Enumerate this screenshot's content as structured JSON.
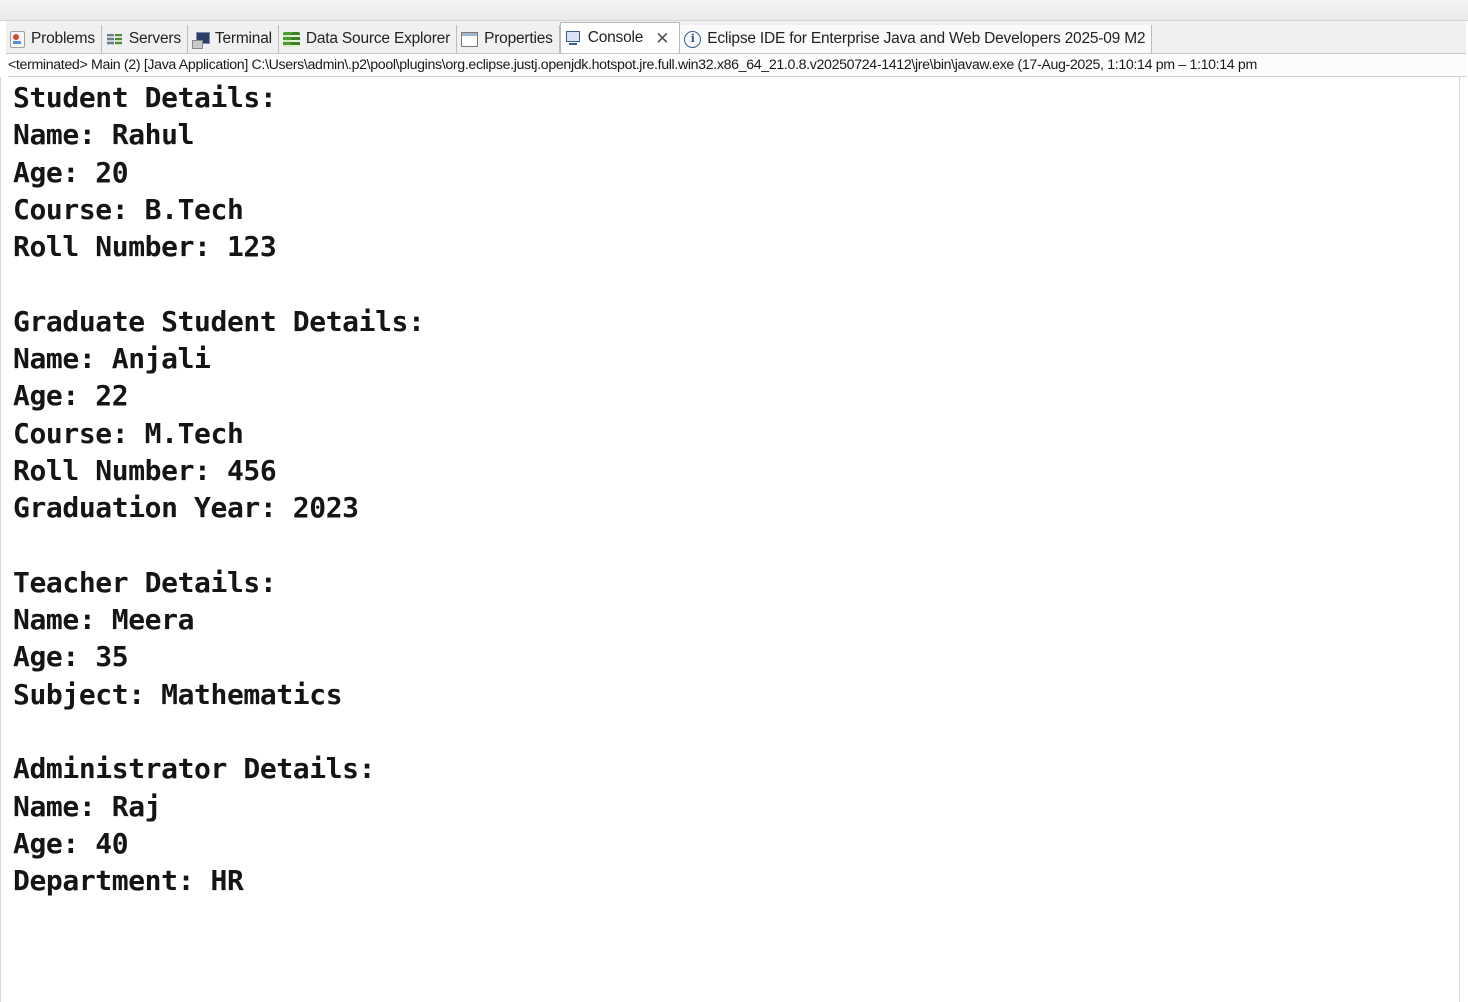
{
  "tabs": [
    {
      "label": "Problems",
      "icon": "problems-icon"
    },
    {
      "label": "Servers",
      "icon": "servers-icon"
    },
    {
      "label": "Terminal",
      "icon": "terminal-icon"
    },
    {
      "label": "Data Source Explorer",
      "icon": "data-source-explorer-icon"
    },
    {
      "label": "Properties",
      "icon": "properties-icon"
    },
    {
      "label": "Console",
      "icon": "console-icon",
      "active": true
    },
    {
      "label": "Eclipse IDE for Enterprise Java and Web Developers 2025-09 M2",
      "icon": "info-icon"
    }
  ],
  "close_glyph": "✕",
  "status": "<terminated> Main (2) [Java Application] C:\\Users\\admin\\.p2\\pool\\plugins\\org.eclipse.justj.openjdk.hotspot.jre.full.win32.x86_64_21.0.8.v20250724-1412\\jre\\bin\\javaw.exe  (17-Aug-2025, 1:10:14 pm – 1:10:14 pm",
  "console_lines": [
    "Student Details:",
    "Name: Rahul",
    "Age: 20",
    "Course: B.Tech",
    "Roll Number: 123",
    "",
    "Graduate Student Details:",
    "Name: Anjali",
    "Age: 22",
    "Course: M.Tech",
    "Roll Number: 456",
    "Graduation Year: 2023",
    "",
    "Teacher Details:",
    "Name: Meera",
    "Age: 35",
    "Subject: Mathematics",
    "",
    "Administrator Details:",
    "Name: Raj",
    "Age: 40",
    "Department: HR"
  ]
}
